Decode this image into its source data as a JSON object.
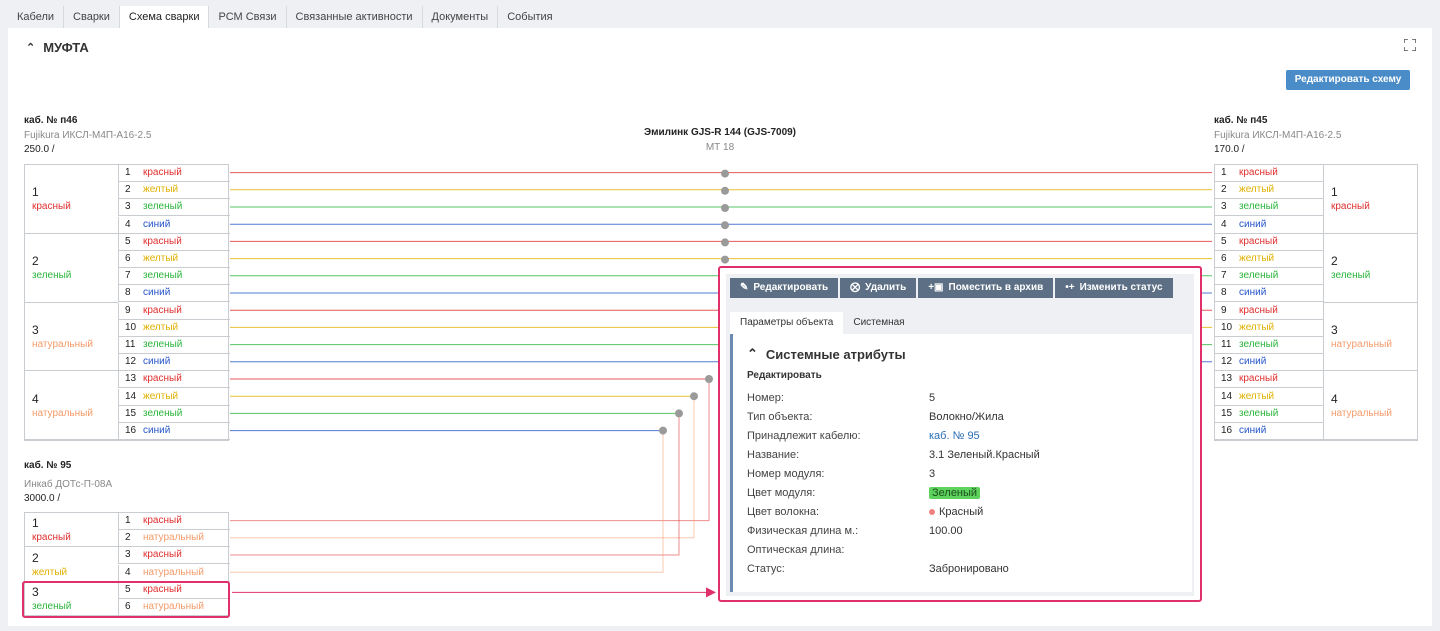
{
  "tabs": [
    "Кабели",
    "Сварки",
    "Схема сварки",
    "РСМ Связи",
    "Связанные активности",
    "Документы",
    "События"
  ],
  "active_tab": "Схема сварки",
  "section_title": "МУФТА",
  "edit_scheme_label": "Редактировать схему",
  "device": {
    "name": "Эмилинк GJS-R 144 (GJS-7009)",
    "model": "МТ 18"
  },
  "colors": {
    "красный": "#e03030",
    "желтый": "#e0b000",
    "зеленый": "#2bb53c",
    "синий": "#2656c8",
    "натуральный": "#f59b6a",
    "accent": "#e0306a",
    "button": "#4a8cc7"
  },
  "cable_left": {
    "name": "каб. № п46",
    "model": "Fujikura ИКСЛ-М4П-А16-2.5",
    "length": "250.0 /",
    "modules": [
      {
        "num": "1",
        "color": "красный"
      },
      {
        "num": "2",
        "color": "зеленый"
      },
      {
        "num": "3",
        "color": "натуральный"
      },
      {
        "num": "4",
        "color": "натуральный"
      }
    ],
    "fibers": [
      {
        "num": "1",
        "color": "красный"
      },
      {
        "num": "2",
        "color": "желтый"
      },
      {
        "num": "3",
        "color": "зеленый"
      },
      {
        "num": "4",
        "color": "синий"
      },
      {
        "num": "5",
        "color": "красный"
      },
      {
        "num": "6",
        "color": "желтый"
      },
      {
        "num": "7",
        "color": "зеленый"
      },
      {
        "num": "8",
        "color": "синий"
      },
      {
        "num": "9",
        "color": "красный"
      },
      {
        "num": "10",
        "color": "желтый"
      },
      {
        "num": "11",
        "color": "зеленый"
      },
      {
        "num": "12",
        "color": "синий"
      },
      {
        "num": "13",
        "color": "красный"
      },
      {
        "num": "14",
        "color": "желтый"
      },
      {
        "num": "15",
        "color": "зеленый"
      },
      {
        "num": "16",
        "color": "синий"
      }
    ]
  },
  "cable_right": {
    "name": "каб. № п45",
    "model": "Fujikura ИКСЛ-М4П-А16-2.5",
    "length": "170.0 /",
    "modules": [
      {
        "num": "1",
        "color": "красный"
      },
      {
        "num": "2",
        "color": "зеленый"
      },
      {
        "num": "3",
        "color": "натуральный"
      },
      {
        "num": "4",
        "color": "натуральный"
      }
    ],
    "fibers": [
      {
        "num": "1",
        "color": "красный"
      },
      {
        "num": "2",
        "color": "желтый"
      },
      {
        "num": "3",
        "color": "зеленый"
      },
      {
        "num": "4",
        "color": "синий"
      },
      {
        "num": "5",
        "color": "красный"
      },
      {
        "num": "6",
        "color": "желтый"
      },
      {
        "num": "7",
        "color": "зеленый"
      },
      {
        "num": "8",
        "color": "синий"
      },
      {
        "num": "9",
        "color": "красный"
      },
      {
        "num": "10",
        "color": "желтый"
      },
      {
        "num": "11",
        "color": "зеленый"
      },
      {
        "num": "12",
        "color": "синий"
      },
      {
        "num": "13",
        "color": "красный"
      },
      {
        "num": "14",
        "color": "желтый"
      },
      {
        "num": "15",
        "color": "зеленый"
      },
      {
        "num": "16",
        "color": "синий"
      }
    ]
  },
  "cable_bottom": {
    "name": "каб. № 95",
    "model": "Инкаб ДОТс-П-08А",
    "length": "3000.0 /",
    "modules": [
      {
        "num": "1",
        "color": "красный"
      },
      {
        "num": "2",
        "color": "желтый"
      },
      {
        "num": "3",
        "color": "зеленый"
      }
    ],
    "fibers": [
      {
        "num": "1",
        "color": "красный"
      },
      {
        "num": "2",
        "color": "натуральный"
      },
      {
        "num": "3",
        "color": "красный"
      },
      {
        "num": "4",
        "color": "натуральный"
      },
      {
        "num": "5",
        "color": "красный"
      },
      {
        "num": "6",
        "color": "натуральный"
      }
    ]
  },
  "popup": {
    "toolbar": [
      "Редактировать",
      "Удалить",
      "Поместить в архив",
      "Изменить статус"
    ],
    "tabs": [
      "Параметры объекта",
      "Системная"
    ],
    "section_title": "Системные атрибуты",
    "edit_label": "Редактировать",
    "attributes": [
      {
        "label": "Номер:",
        "value": "5"
      },
      {
        "label": "Тип объекта:",
        "value": "Волокно/Жила"
      },
      {
        "label": "Принадлежит кабелю:",
        "value": "каб. № 95"
      },
      {
        "label": "Название:",
        "value": "3.1 Зеленый.Красный"
      },
      {
        "label": "Номер модуля:",
        "value": "3"
      },
      {
        "label": "Цвет модуля:",
        "value": "Зеленый"
      },
      {
        "label": "Цвет волокна:",
        "value": "Красный"
      },
      {
        "label": "Физическая длина м.:",
        "value": "100.00"
      },
      {
        "label": "Оптическая длина:",
        "value": ""
      },
      {
        "label": "Статус:",
        "value": "Забронировано"
      }
    ]
  }
}
